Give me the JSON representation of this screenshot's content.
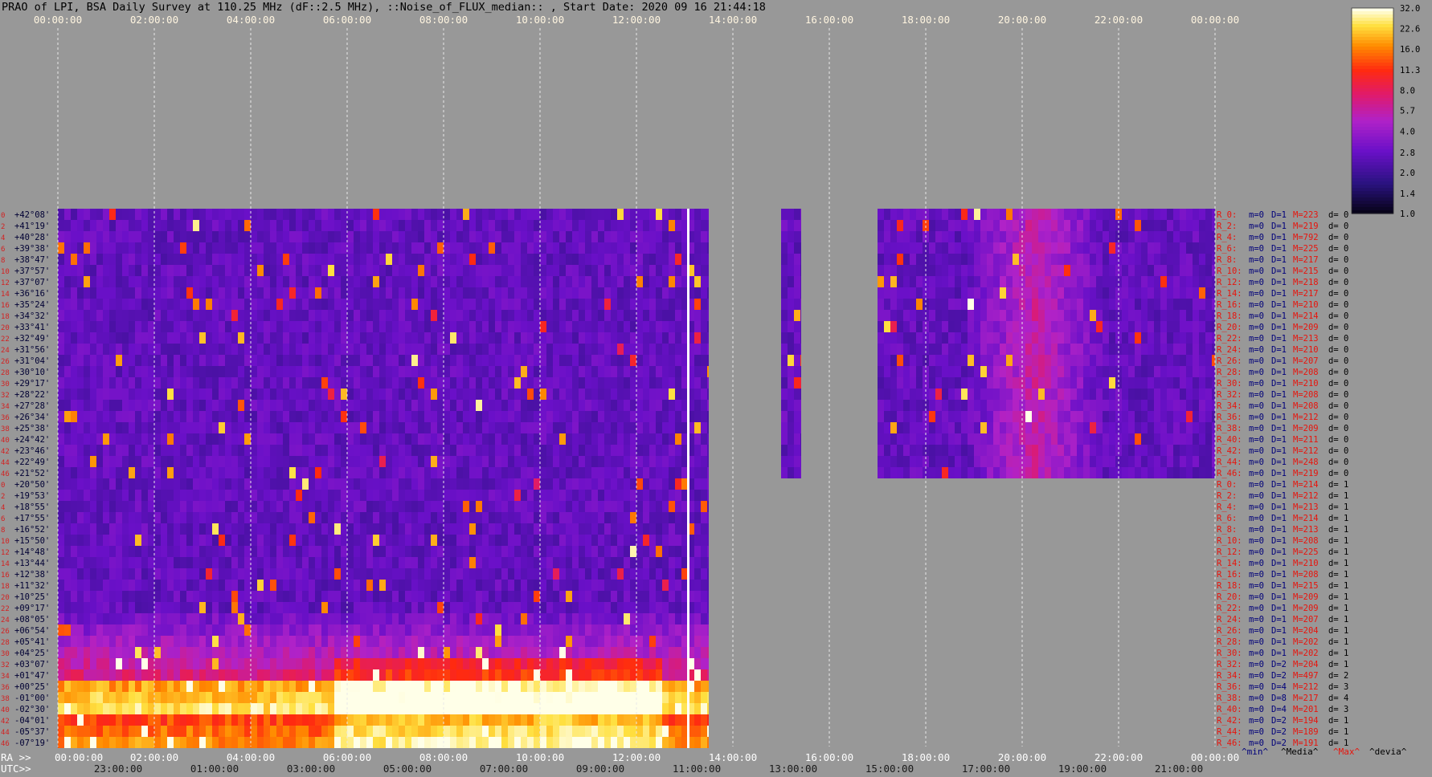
{
  "title": "PRAO of LPI, BSA Daily Survey at 110.25 MHz (dF::2.5 MHz), ::Noise_of_FLUX_median:: , Start Date: 2020 09 16 21:44:18",
  "colors": {
    "background": "#989898",
    "gridline": "#e8e8e8",
    "declination_label": "#000033",
    "row_number": "#d22222",
    "stat_red": "#e8140c",
    "stat_navy": "#00007a",
    "stat_black": "#000000",
    "footer_media": "#000000",
    "footer_max": "#e8140c"
  },
  "chart_data": {
    "type": "heatmap",
    "top_axis_ticks": [
      "00:00:00",
      "02:00:00",
      "04:00:00",
      "06:00:00",
      "08:00:00",
      "10:00:00",
      "12:00:00",
      "14:00:00",
      "16:00:00",
      "18:00:00",
      "20:00:00",
      "22:00:00",
      "00:00:00"
    ],
    "bottom_axis_ra_ticks": [
      "00:00:00",
      "02:00:00",
      "04:00:00",
      "06:00:00",
      "08:00:00",
      "10:00:00",
      "12:00:00",
      "14:00:00",
      "16:00:00",
      "18:00:00",
      "20:00:00",
      "22:00:00",
      "00:00:00"
    ],
    "bottom_axis_utc_ticks": [
      "23:00:00",
      "01:00:00",
      "03:00:00",
      "05:00:00",
      "07:00:00",
      "09:00:00",
      "11:00:00",
      "13:00:00",
      "15:00:00",
      "17:00:00",
      "19:00:00",
      "21:00:00"
    ],
    "bottom_axis_ra_label": "RA >>",
    "bottom_axis_utc_label": "UTC>>",
    "colorbar": {
      "ticks": [
        "32.0",
        "22.6",
        "16.0",
        "11.3",
        "8.0",
        "5.7",
        "4.0",
        "2.8",
        "2.0",
        "1.4",
        "1.0"
      ],
      "scale": "log",
      "range": [
        1.0,
        32.0
      ]
    },
    "row_numbers": [
      "0",
      "2",
      "4",
      "6",
      "8",
      "10",
      "12",
      "14",
      "16",
      "18",
      "20",
      "22",
      "24",
      "26",
      "28",
      "30",
      "32",
      "34",
      "36",
      "38",
      "40",
      "42",
      "44",
      "46",
      "0",
      "2",
      "4",
      "6",
      "8",
      "10",
      "12",
      "14",
      "16",
      "18",
      "20",
      "22",
      "24",
      "26",
      "28",
      "30",
      "32",
      "34",
      "36",
      "38",
      "40",
      "42",
      "44",
      "46"
    ],
    "declinations": [
      "+42°08'",
      "+41°19'",
      "+40°28'",
      "+39°38'",
      "+38°47'",
      "+37°57'",
      "+37°07'",
      "+36°16'",
      "+35°24'",
      "+34°32'",
      "+33°41'",
      "+32°49'",
      "+31°56'",
      "+31°04'",
      "+30°10'",
      "+29°17'",
      "+28°22'",
      "+27°28'",
      "+26°34'",
      "+25°38'",
      "+24°42'",
      "+23°46'",
      "+22°49'",
      "+21°52'",
      "+20°50'",
      "+19°53'",
      "+18°55'",
      "+17°55'",
      "+16°52'",
      "+15°50'",
      "+14°48'",
      "+13°44'",
      "+12°38'",
      "+11°32'",
      "+10°25'",
      "+09°17'",
      "+08°05'",
      "+06°54'",
      "+05°41'",
      "+04°25'",
      "+03°07'",
      "+01°47'",
      "+00°25'",
      "-01°00'",
      "-02°30'",
      "-04°01'",
      "-05°37'",
      "-07°19'"
    ],
    "data_coverage": [
      {
        "ra_start": "00:00:00",
        "ra_end": "13:30:00",
        "rows": "all"
      },
      {
        "ra_start": "15:00:00",
        "ra_end": "15:25:00",
        "rows": "R_0 to R_46 (d=0)"
      },
      {
        "ra_start": "17:00:00",
        "ra_end": "24:00:00",
        "rows": "R_0 to R_46 (d=0)"
      }
    ],
    "row_stats": [
      {
        "label": "R_0:",
        "min": "m=0",
        "disp": "D=1",
        "max": "M=223",
        "dev": "d= 0"
      },
      {
        "label": "R_2:",
        "min": "m=0",
        "disp": "D=1",
        "max": "M=219",
        "dev": "d= 0"
      },
      {
        "label": "R_4:",
        "min": "m=0",
        "disp": "D=1",
        "max": "M=792",
        "dev": "d= 0"
      },
      {
        "label": "R_6:",
        "min": "m=0",
        "disp": "D=1",
        "max": "M=225",
        "dev": "d= 0"
      },
      {
        "label": "R_8:",
        "min": "m=0",
        "disp": "D=1",
        "max": "M=217",
        "dev": "d= 0"
      },
      {
        "label": "R_10:",
        "min": "m=0",
        "disp": "D=1",
        "max": "M=215",
        "dev": "d= 0"
      },
      {
        "label": "R_12:",
        "min": "m=0",
        "disp": "D=1",
        "max": "M=218",
        "dev": "d= 0"
      },
      {
        "label": "R_14:",
        "min": "m=0",
        "disp": "D=1",
        "max": "M=217",
        "dev": "d= 0"
      },
      {
        "label": "R_16:",
        "min": "m=0",
        "disp": "D=1",
        "max": "M=210",
        "dev": "d= 0"
      },
      {
        "label": "R_18:",
        "min": "m=0",
        "disp": "D=1",
        "max": "M=214",
        "dev": "d= 0"
      },
      {
        "label": "R_20:",
        "min": "m=0",
        "disp": "D=1",
        "max": "M=209",
        "dev": "d= 0"
      },
      {
        "label": "R_22:",
        "min": "m=0",
        "disp": "D=1",
        "max": "M=213",
        "dev": "d= 0"
      },
      {
        "label": "R_24:",
        "min": "m=0",
        "disp": "D=1",
        "max": "M=210",
        "dev": "d= 0"
      },
      {
        "label": "R_26:",
        "min": "m=0",
        "disp": "D=1",
        "max": "M=207",
        "dev": "d= 0"
      },
      {
        "label": "R_28:",
        "min": "m=0",
        "disp": "D=1",
        "max": "M=208",
        "dev": "d= 0"
      },
      {
        "label": "R_30:",
        "min": "m=0",
        "disp": "D=1",
        "max": "M=210",
        "dev": "d= 0"
      },
      {
        "label": "R_32:",
        "min": "m=0",
        "disp": "D=1",
        "max": "M=208",
        "dev": "d= 0"
      },
      {
        "label": "R_34:",
        "min": "m=0",
        "disp": "D=1",
        "max": "M=208",
        "dev": "d= 0"
      },
      {
        "label": "R_36:",
        "min": "m=0",
        "disp": "D=1",
        "max": "M=212",
        "dev": "d= 0"
      },
      {
        "label": "R_38:",
        "min": "m=0",
        "disp": "D=1",
        "max": "M=209",
        "dev": "d= 0"
      },
      {
        "label": "R_40:",
        "min": "m=0",
        "disp": "D=1",
        "max": "M=211",
        "dev": "d= 0"
      },
      {
        "label": "R_42:",
        "min": "m=0",
        "disp": "D=1",
        "max": "M=212",
        "dev": "d= 0"
      },
      {
        "label": "R_44:",
        "min": "m=0",
        "disp": "D=1",
        "max": "M=248",
        "dev": "d= 0"
      },
      {
        "label": "R_46:",
        "min": "m=0",
        "disp": "D=1",
        "max": "M=219",
        "dev": "d= 0"
      },
      {
        "label": "R_0:",
        "min": "m=0",
        "disp": "D=1",
        "max": "M=214",
        "dev": "d= 1"
      },
      {
        "label": "R_2:",
        "min": "m=0",
        "disp": "D=1",
        "max": "M=212",
        "dev": "d= 1"
      },
      {
        "label": "R_4:",
        "min": "m=0",
        "disp": "D=1",
        "max": "M=213",
        "dev": "d= 1"
      },
      {
        "label": "R_6:",
        "min": "m=0",
        "disp": "D=1",
        "max": "M=214",
        "dev": "d= 1"
      },
      {
        "label": "R_8:",
        "min": "m=0",
        "disp": "D=1",
        "max": "M=213",
        "dev": "d= 1"
      },
      {
        "label": "R_10:",
        "min": "m=0",
        "disp": "D=1",
        "max": "M=208",
        "dev": "d= 1"
      },
      {
        "label": "R_12:",
        "min": "m=0",
        "disp": "D=1",
        "max": "M=225",
        "dev": "d= 1"
      },
      {
        "label": "R_14:",
        "min": "m=0",
        "disp": "D=1",
        "max": "M=210",
        "dev": "d= 1"
      },
      {
        "label": "R_16:",
        "min": "m=0",
        "disp": "D=1",
        "max": "M=208",
        "dev": "d= 1"
      },
      {
        "label": "R_18:",
        "min": "m=0",
        "disp": "D=1",
        "max": "M=215",
        "dev": "d= 1"
      },
      {
        "label": "R_20:",
        "min": "m=0",
        "disp": "D=1",
        "max": "M=209",
        "dev": "d= 1"
      },
      {
        "label": "R_22:",
        "min": "m=0",
        "disp": "D=1",
        "max": "M=209",
        "dev": "d= 1"
      },
      {
        "label": "R_24:",
        "min": "m=0",
        "disp": "D=1",
        "max": "M=207",
        "dev": "d= 1"
      },
      {
        "label": "R_26:",
        "min": "m=0",
        "disp": "D=1",
        "max": "M=204",
        "dev": "d= 1"
      },
      {
        "label": "R_28:",
        "min": "m=0",
        "disp": "D=1",
        "max": "M=202",
        "dev": "d= 1"
      },
      {
        "label": "R_30:",
        "min": "m=0",
        "disp": "D=1",
        "max": "M=202",
        "dev": "d= 1"
      },
      {
        "label": "R_32:",
        "min": "m=0",
        "disp": "D=2",
        "max": "M=204",
        "dev": "d= 1"
      },
      {
        "label": "R_34:",
        "min": "m=0",
        "disp": "D=2",
        "max": "M=497",
        "dev": "d= 2"
      },
      {
        "label": "R_36:",
        "min": "m=0",
        "disp": "D=4",
        "max": "M=212",
        "dev": "d= 3"
      },
      {
        "label": "R_38:",
        "min": "m=0",
        "disp": "D=8",
        "max": "M=217",
        "dev": "d= 4"
      },
      {
        "label": "R_40:",
        "min": "m=0",
        "disp": "D=4",
        "max": "M=201",
        "dev": "d= 3"
      },
      {
        "label": "R_42:",
        "min": "m=0",
        "disp": "D=2",
        "max": "M=194",
        "dev": "d= 1"
      },
      {
        "label": "R_44:",
        "min": "m=0",
        "disp": "D=2",
        "max": "M=189",
        "dev": "d= 1"
      },
      {
        "label": "R_46:",
        "min": "m=0",
        "disp": "D=2",
        "max": "M=191",
        "dev": "d= 1"
      }
    ],
    "footer_legend": {
      "min": "^min^",
      "media": "^Media^",
      "max": "^Max^",
      "devia": "^devia^"
    }
  }
}
